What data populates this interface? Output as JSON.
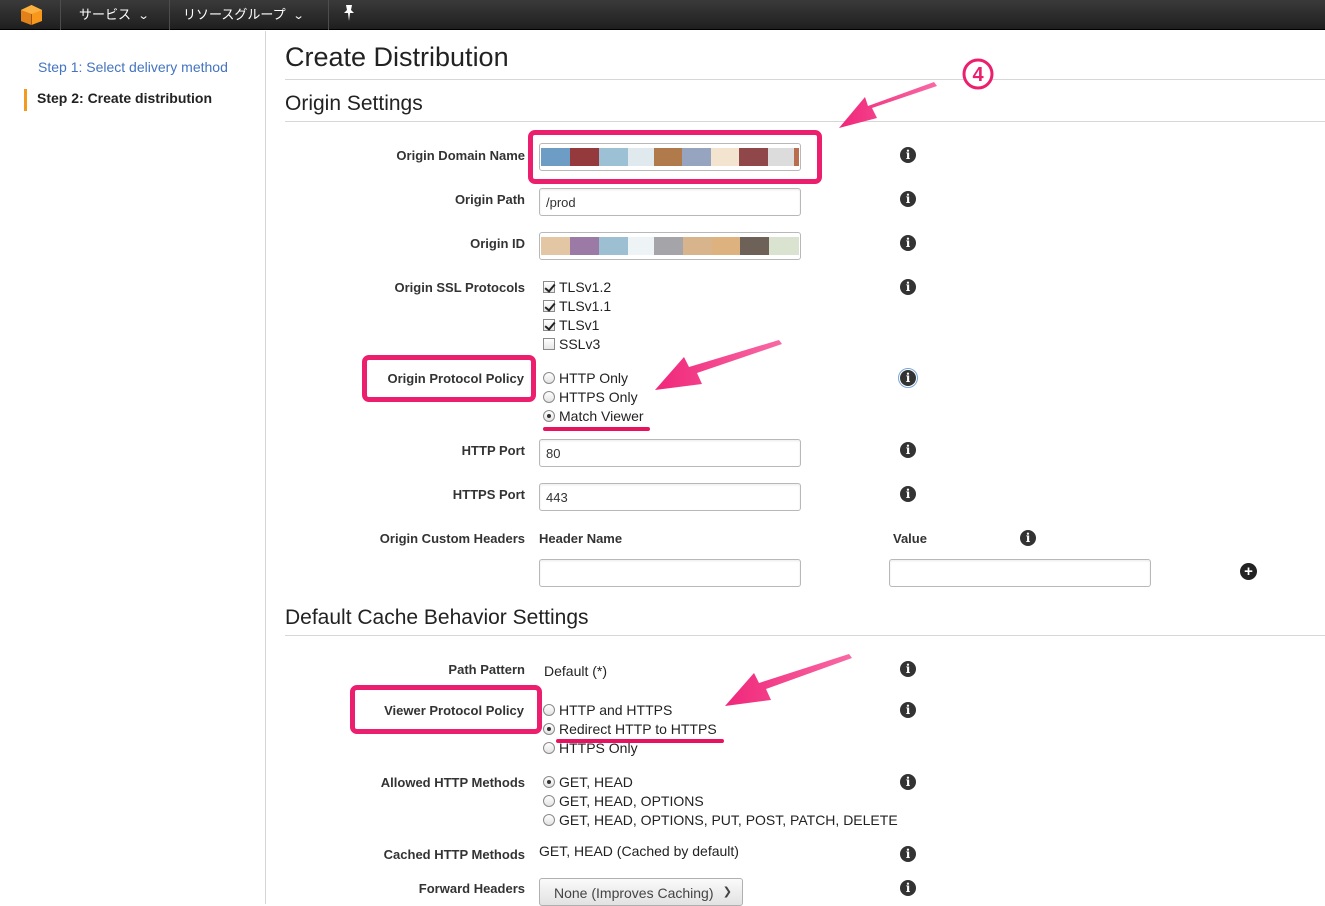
{
  "topbar": {
    "services_label": "サービス",
    "resource_groups_label": "リソースグループ",
    "logo_icon": "aws-cube-icon",
    "pin_icon": "pin-icon"
  },
  "sidebar": {
    "steps": [
      {
        "label": "Step 1: Select delivery method"
      },
      {
        "label": "Step 2: Create distribution"
      }
    ]
  },
  "page": {
    "title": "Create Distribution",
    "origin_section_title": "Origin Settings",
    "cache_section_title": "Default Cache Behavior Settings"
  },
  "origin": {
    "domain_name_label": "Origin Domain Name",
    "path_label": "Origin Path",
    "path_value": "/prod",
    "id_label": "Origin ID",
    "ssl_label": "Origin SSL Protocols",
    "ssl_options": [
      {
        "label": "TLSv1.2"
      },
      {
        "label": "TLSv1.1"
      },
      {
        "label": "TLSv1"
      },
      {
        "label": "SSLv3"
      }
    ],
    "protocol_policy_label": "Origin Protocol Policy",
    "protocol_policy_options": [
      {
        "label": "HTTP Only"
      },
      {
        "label": "HTTPS Only"
      },
      {
        "label": "Match Viewer"
      }
    ],
    "http_port_label": "HTTP Port",
    "http_port_value": "80",
    "https_port_label": "HTTPS Port",
    "https_port_value": "443",
    "custom_headers_label": "Origin Custom Headers",
    "header_name_label": "Header Name",
    "value_label": "Value"
  },
  "cache": {
    "path_pattern_label": "Path Pattern",
    "path_pattern_value": "Default (*)",
    "viewer_policy_label": "Viewer Protocol Policy",
    "viewer_policy_options": [
      {
        "label": "HTTP and HTTPS"
      },
      {
        "label": "Redirect HTTP to HTTPS"
      },
      {
        "label": "HTTPS Only"
      }
    ],
    "allowed_methods_label": "Allowed HTTP Methods",
    "allowed_methods_options": [
      {
        "label": "GET, HEAD"
      },
      {
        "label": "GET, HEAD, OPTIONS"
      },
      {
        "label": "GET, HEAD, OPTIONS, PUT, POST, PATCH, DELETE"
      }
    ],
    "cached_methods_label": "Cached HTTP Methods",
    "cached_methods_value": "GET, HEAD (Cached by default)",
    "forward_headers_label": "Forward Headers",
    "forward_headers_value": "None (Improves Caching)"
  },
  "annotation": {
    "step_number": "4",
    "highlight_color": "#ec1f6e"
  }
}
